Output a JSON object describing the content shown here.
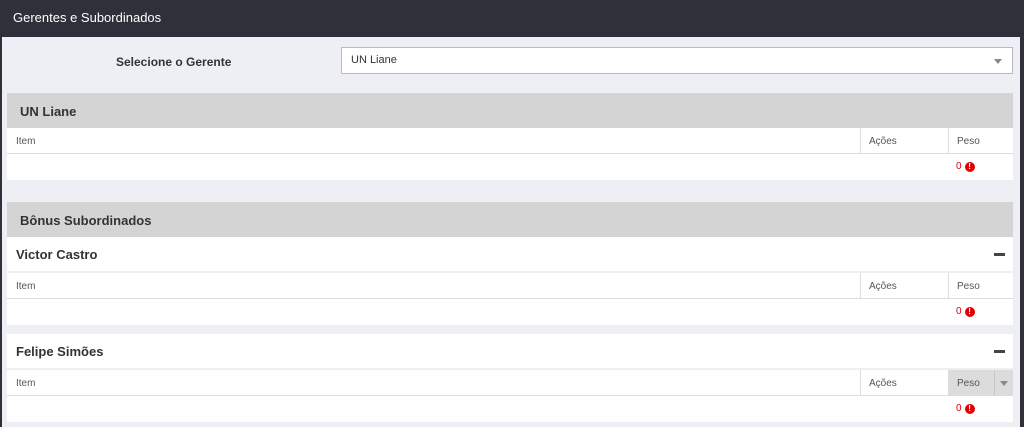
{
  "window": {
    "title": "Gerentes e Subordinados"
  },
  "selector": {
    "label": "Selecione o Gerente",
    "value": "UN Liane"
  },
  "manager_section": {
    "title": "UN Liane",
    "columns": {
      "item": "Item",
      "acoes": "Ações",
      "peso": "Peso"
    },
    "total": "0"
  },
  "subordinates_section": {
    "title": "Bônus Subordinados",
    "people": [
      {
        "name": "Victor Castro",
        "columns": {
          "item": "Item",
          "acoes": "Ações",
          "peso": "Peso"
        },
        "total": "0"
      },
      {
        "name": "Felipe Simões",
        "columns": {
          "item": "Item",
          "acoes": "Ações",
          "peso": "Peso"
        },
        "total": "0"
      }
    ]
  },
  "icons": {
    "warning": "exclamation-circle-icon",
    "collapse": "minus-icon",
    "dropdown": "caret-down-icon"
  },
  "colors": {
    "titlebar": "#2f3039",
    "warning": "#e00000",
    "section_header": "#d4d4d4"
  }
}
